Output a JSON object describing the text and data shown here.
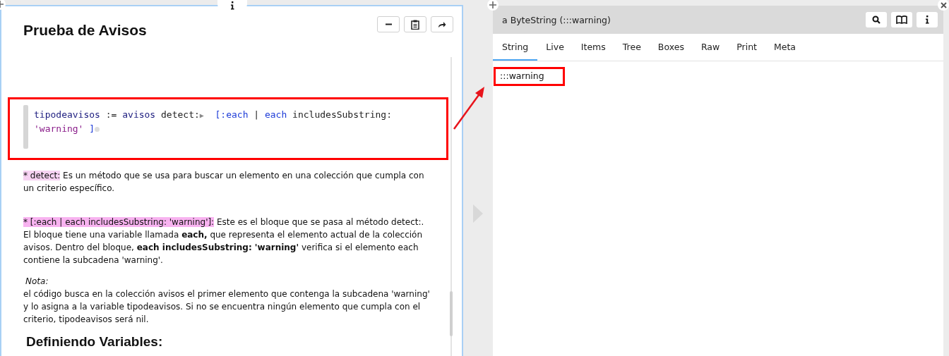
{
  "left_pane": {
    "title": "Prueba de Avisos",
    "code": [
      {
        "kind": "var",
        "text": "tipodeavisos"
      },
      {
        "kind": "plain",
        "text": " := "
      },
      {
        "kind": "var",
        "text": "avisos"
      },
      {
        "kind": "plain",
        "text": " detect:"
      },
      {
        "kind": "marker",
        "text": "▶"
      },
      {
        "kind": "block",
        "text": "  [:each"
      },
      {
        "kind": "plain",
        "text": " | "
      },
      {
        "kind": "block",
        "text": "each"
      },
      {
        "kind": "plain",
        "text": " includesSubstring: "
      },
      {
        "kind": "string",
        "text": "'warning'"
      },
      {
        "kind": "block",
        "text": " ]"
      }
    ],
    "notes": [
      {
        "highlight": "* detect:",
        "text": " Es un método que se usa para buscar un elemento en una colección que cumpla con un criterio específico."
      },
      {
        "highlight": "* [:each | each includesSubstring: 'warning']:",
        "text": " Este es el bloque que se pasa al método detect:. El bloque tiene una variable llamada **each,**  que representa el elemento actual de la colección avisos. Dentro del bloque, **each includesSubstring: 'warning'**  verifica si el elemento each contiene la subcadena 'warning'."
      }
    ],
    "note_label": "Nota:",
    "note_text": "el código busca en la colección avisos el primer elemento que contenga la subcadena 'warning' y lo asigna a la variable tipodeavisos. Si no se encuentra ningún elemento que cumpla con el criterio, tipodeavisos será nil.",
    "next_heading": "Definiendo Variables:"
  },
  "right_pane": {
    "title": "a ByteString (:::warning)",
    "tabs": [
      {
        "label": "String",
        "selected": true
      },
      {
        "label": "Live",
        "selected": false
      },
      {
        "label": "Items",
        "selected": false
      },
      {
        "label": "Tree",
        "selected": false
      },
      {
        "label": "Boxes",
        "selected": false
      },
      {
        "label": "Raw",
        "selected": false
      },
      {
        "label": "Print",
        "selected": false
      },
      {
        "label": "Meta",
        "selected": false
      }
    ],
    "value": ":::warning"
  }
}
